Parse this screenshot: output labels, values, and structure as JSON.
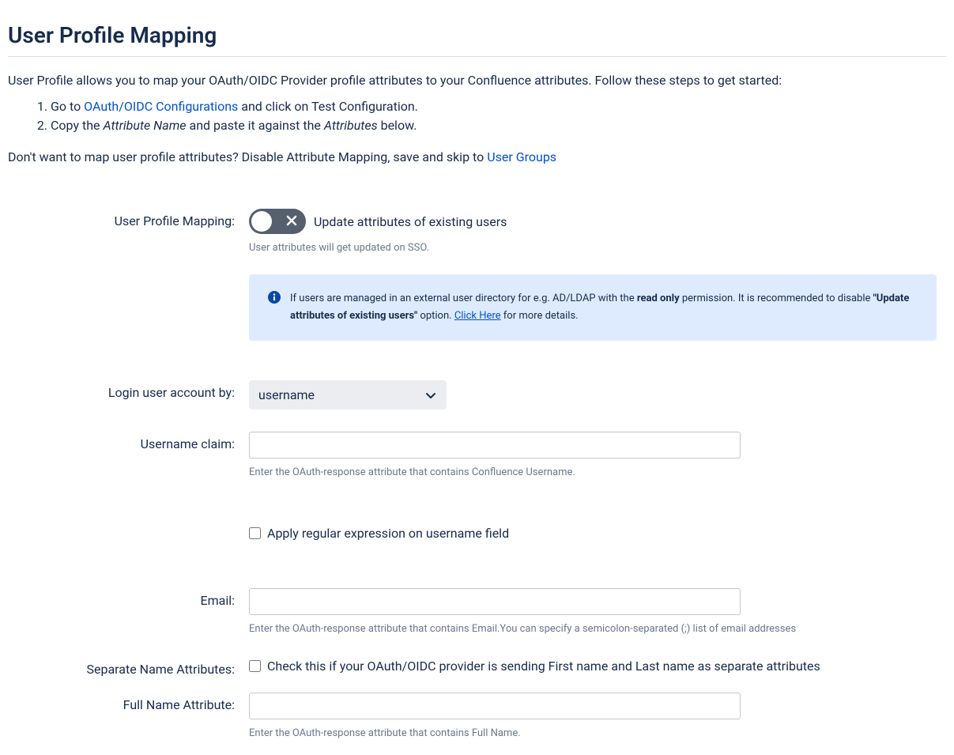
{
  "header": {
    "title": "User Profile Mapping"
  },
  "intro": {
    "text": "User Profile allows you to map your OAuth/OIDC Provider profile attributes to your Confluence attributes. Follow these steps to get started:"
  },
  "steps": {
    "step1_prefix": "Go to ",
    "step1_link": "OAuth/OIDC Configurations",
    "step1_suffix": " and click on Test Configuration.",
    "step2_prefix": "Copy the ",
    "step2_em1": "Attribute Name",
    "step2_mid": " and paste it against the ",
    "step2_em2": "Attributes",
    "step2_suffix": " below."
  },
  "skip": {
    "prefix": "Don't want to map user profile attributes? Disable Attribute Mapping, save and skip to ",
    "link": "User Groups"
  },
  "form": {
    "user_profile_mapping_label": "User Profile Mapping:",
    "toggle_label": "Update attributes of existing users",
    "toggle_state": "off",
    "toggle_helper": "User attributes will get updated on SSO.",
    "info_panel": {
      "text_prefix": "If users are managed in an external user directory for e.g. AD/LDAP with the ",
      "bold1": "read only",
      "text_mid": " permission. It is recommended to disable ",
      "bold2": "\"Update attributes of existing users\"",
      "text_after_bold2": " option. ",
      "link": "Click Here",
      "text_suffix": " for more details."
    },
    "login_by_label": "Login user account by:",
    "login_by_value": "username",
    "username_claim_label": "Username claim:",
    "username_claim_value": "",
    "username_claim_helper": "Enter the OAuth-response attribute that contains Confluence Username.",
    "regex_checkbox_label": "Apply regular expression on username field",
    "regex_checked": false,
    "email_label": "Email:",
    "email_value": "",
    "email_helper": "Enter the OAuth-response attribute that contains Email.You can specify a semicolon-separated (;) list of email addresses",
    "separate_names_label": "Separate Name Attributes:",
    "separate_names_checkbox_label": "Check this if your OAuth/OIDC provider is sending First name and Last name as separate attributes",
    "separate_names_checked": false,
    "fullname_label": "Full Name Attribute:",
    "fullname_value": "",
    "fullname_helper": "Enter the OAuth-response attribute that contains Full Name."
  }
}
